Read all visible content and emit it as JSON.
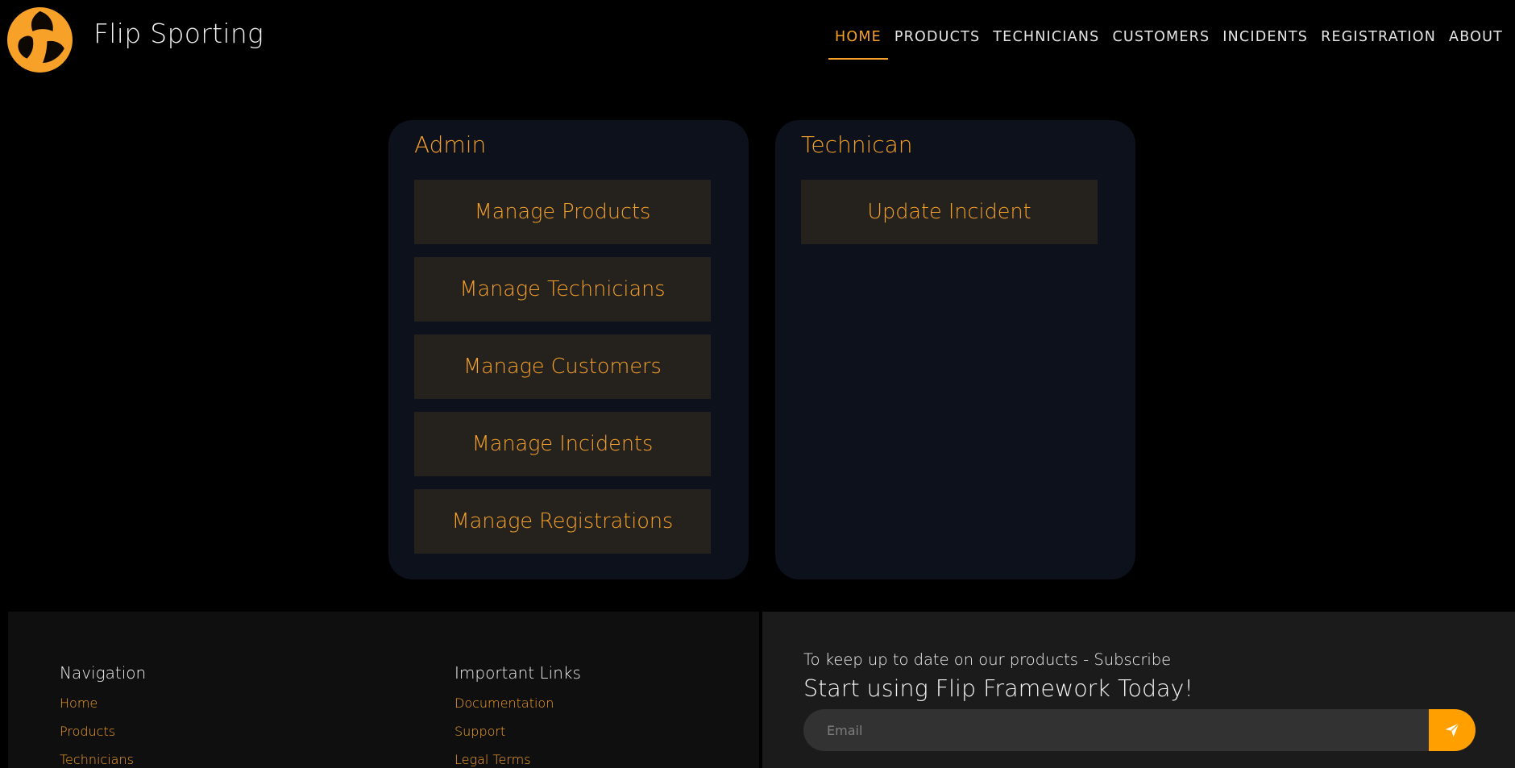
{
  "brand": {
    "name": "Flip Sporting",
    "accent_color": "#f7a129"
  },
  "nav": {
    "items": [
      {
        "label": "HOME",
        "active": true
      },
      {
        "label": "PRODUCTS",
        "active": false
      },
      {
        "label": "TECHNICIANS",
        "active": false
      },
      {
        "label": "CUSTOMERS",
        "active": false
      },
      {
        "label": "INCIDENTS",
        "active": false
      },
      {
        "label": "REGISTRATION",
        "active": false
      },
      {
        "label": "ABOUT",
        "active": false
      }
    ]
  },
  "admin": {
    "title": "Admin",
    "buttons": [
      "Manage Products",
      "Manage Technicians",
      "Manage Customers",
      "Manage Incidents",
      "Manage Registrations"
    ]
  },
  "technician": {
    "title": "Technican",
    "buttons": [
      "Update Incident"
    ]
  },
  "footer": {
    "navigation": {
      "heading": "Navigation",
      "links": [
        "Home",
        "Products",
        "Technicians"
      ]
    },
    "important": {
      "heading": "Important Links",
      "links": [
        "Documentation",
        "Support",
        "Legal Terms"
      ]
    },
    "subscribe": {
      "text": "To keep up to date on our products - Subscribe",
      "heading": "Start using Flip Framework Today!",
      "email_placeholder": "Email",
      "send_icon": "paper-plane-icon"
    }
  }
}
